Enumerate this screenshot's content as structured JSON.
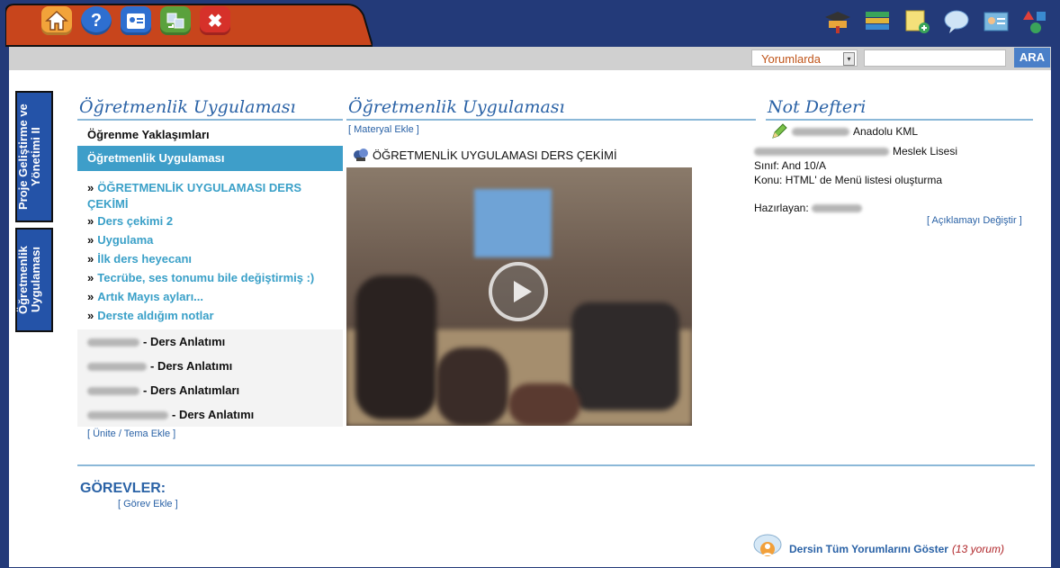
{
  "toolbar": {
    "icons": [
      "home-icon",
      "help-icon",
      "contact-card-icon",
      "sync-icon",
      "close-icon"
    ],
    "right_icons": [
      "graduation-icon",
      "books-icon",
      "note-add-icon",
      "speech-bubble-icon",
      "profile-card-icon",
      "shapes-icon"
    ]
  },
  "search": {
    "scope_value": "Yorumlarda",
    "query_value": "",
    "button_label": "ARA"
  },
  "side_tabs": [
    "Proje Geliştirme ve Yönetimi II",
    "Öğretmenlik Uygulaması"
  ],
  "left_column": {
    "heading": "Öğretmenlik Uygulaması",
    "items": [
      {
        "label": "Öğrenme Yaklaşımları"
      },
      {
        "label": "Öğretmenlik Uygulaması",
        "active": true
      }
    ],
    "sub_items": [
      "ÖĞRETMENLİK UYGULAMASI DERS ÇEKİMİ",
      "Ders çekimi 2",
      "Uygulama",
      "İlk ders heyecanı",
      "Tecrübe, ses tonumu bile değiştirmiş :)",
      "Artık Mayıs ayları...",
      "Derste aldığım notlar"
    ],
    "anlatim_rows": [
      "- Ders Anlatımı",
      "- Ders Anlatımı",
      "- Ders Anlatımları",
      "- Ders Anlatımı"
    ],
    "add_link": "[ Ünite / Tema Ekle ]"
  },
  "middle_column": {
    "heading": "Öğretmenlik Uygulaması",
    "add_link": "[ Materyal Ekle ]",
    "video_title": "ÖĞRETMENLİK UYGULAMASI DERS ÇEKİMİ"
  },
  "right_column": {
    "heading": "Not Defteri",
    "line1": "Anadolu KML",
    "line2": "Meslek Lisesi",
    "line3": "Sınıf: And 10/A",
    "line4": "Konu: HTML' de Menü listesi oluşturma",
    "prepared_label": "Hazırlayan:",
    "edit_link": "[ Açıklamayı Değiştir ]"
  },
  "tasks": {
    "heading": "GÖREVLER:",
    "add_link": "[ Görev Ekle ]"
  },
  "footer": {
    "comments_link": "Dersin Tüm Yorumlarını Göster",
    "count": "(13 yorum)"
  },
  "colors": {
    "navy": "#233a79",
    "accent": "#3e9ec9",
    "link": "#2a62a6",
    "tab_orange": "#c8451c"
  }
}
